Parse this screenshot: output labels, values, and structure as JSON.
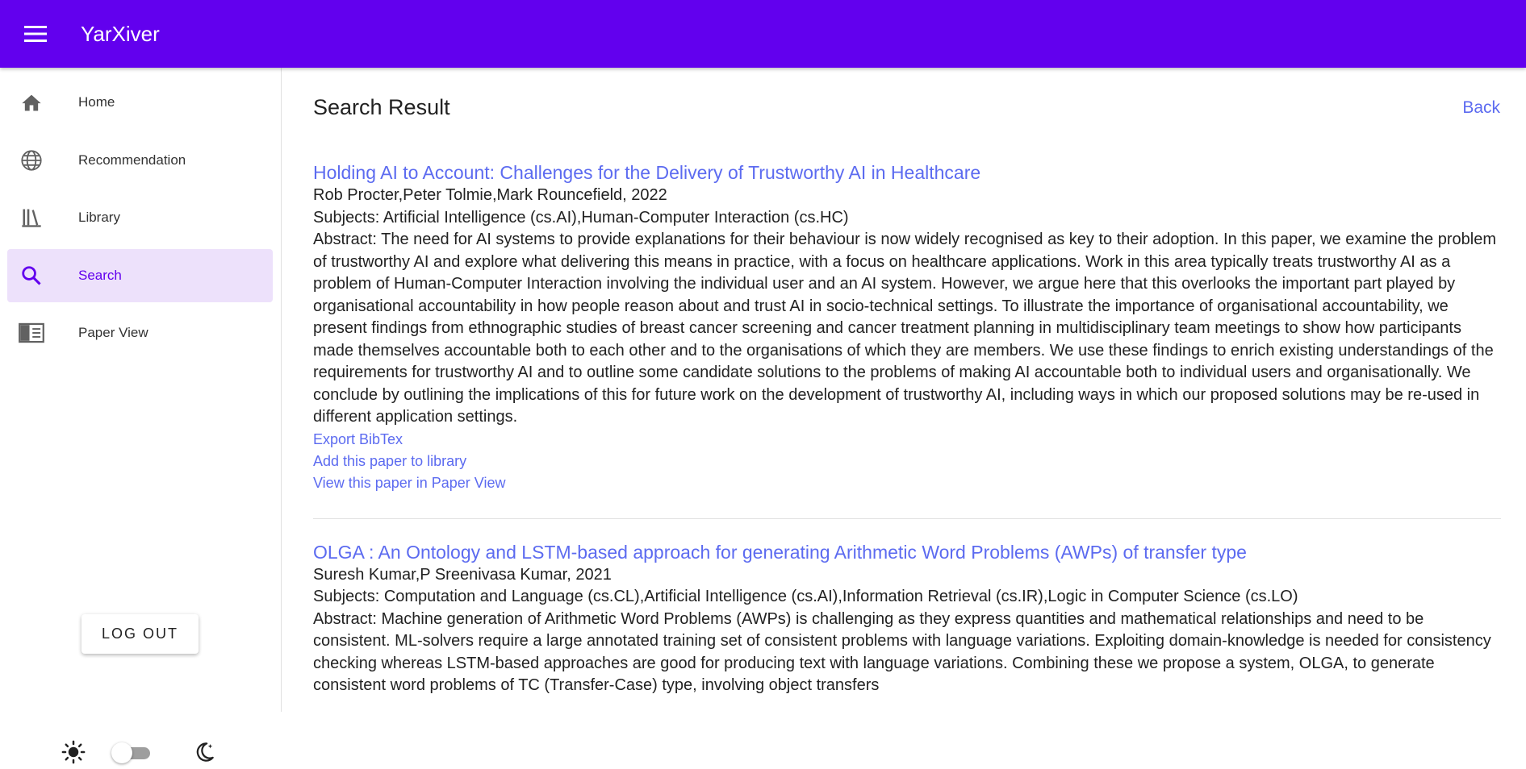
{
  "app": {
    "title": "YarXiver",
    "brand_color": "#6200ee"
  },
  "sidebar": {
    "items": [
      {
        "label": "Home",
        "icon": "home-icon"
      },
      {
        "label": "Recommendation",
        "icon": "globe-icon"
      },
      {
        "label": "Library",
        "icon": "library-icon"
      },
      {
        "label": "Search",
        "icon": "search-icon",
        "active": true
      },
      {
        "label": "Paper View",
        "icon": "paper-view-icon"
      }
    ],
    "logout_label": "LOG OUT",
    "theme_toggle": {
      "dark_mode": false
    }
  },
  "main": {
    "title": "Search Result",
    "back_label": "Back",
    "results": [
      {
        "title": "Holding AI to Account: Challenges for the Delivery of Trustworthy AI in Healthcare",
        "authors_year": "Rob Procter,Peter Tolmie,Mark Rouncefield, 2022",
        "subjects": "Subjects: Artificial Intelligence (cs.AI),Human-Computer Interaction (cs.HC)",
        "abstract": "Abstract: The need for AI systems to provide explanations for their behaviour is now widely recognised as key to their adoption. In this paper, we examine the problem of trustworthy AI and explore what delivering this means in practice, with a focus on healthcare applications. Work in this area typically treats trustworthy AI as a problem of Human-Computer Interaction involving the individual user and an AI system. However, we argue here that this overlooks the important part played by organisational accountability in how people reason about and trust AI in socio-technical settings. To illustrate the importance of organisational accountability, we present findings from ethnographic studies of breast cancer screening and cancer treatment planning in multidisciplinary team meetings to show how participants made themselves accountable both to each other and to the organisations of which they are members. We use these findings to enrich existing understandings of the requirements for trustworthy AI and to outline some candidate solutions to the problems of making AI accountable both to individual users and organisationally. We conclude by outlining the implications of this for future work on the development of trustworthy AI, including ways in which our proposed solutions may be re-used in different application settings.",
        "actions": [
          "Export BibTex",
          "Add this paper to library",
          "View this paper in Paper View"
        ]
      },
      {
        "title": "OLGA : An Ontology and LSTM-based approach for generating Arithmetic Word Problems (AWPs) of transfer type",
        "authors_year": "Suresh Kumar,P Sreenivasa Kumar, 2021",
        "subjects": "Subjects: Computation and Language (cs.CL),Artificial Intelligence (cs.AI),Information Retrieval (cs.IR),Logic in Computer Science (cs.LO)",
        "abstract": "Abstract: Machine generation of Arithmetic Word Problems (AWPs) is challenging as they express quantities and mathematical relationships and need to be consistent. ML-solvers require a large annotated training set of consistent problems with language variations. Exploiting domain-knowledge is needed for consistency checking whereas LSTM-based approaches are good for producing text with language variations. Combining these we propose a system, OLGA, to generate consistent word problems of TC (Transfer-Case) type, involving object transfers",
        "actions": []
      }
    ]
  }
}
